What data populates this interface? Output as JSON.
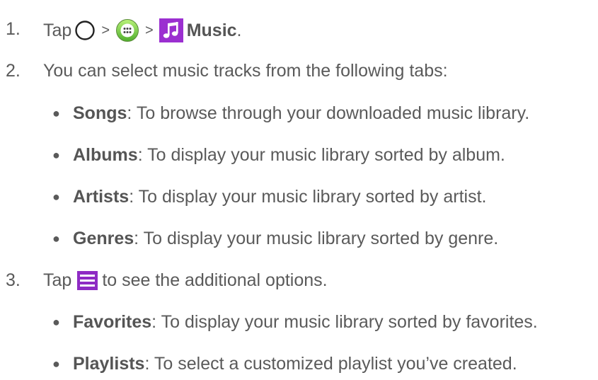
{
  "step1": {
    "number": "1.",
    "tap": "Tap",
    "sep1": ">",
    "sep2": ">",
    "music": "Music",
    "period": ".",
    "icons": [
      "home-icon",
      "apps-icon",
      "music-app-icon"
    ],
    "music_icon_color": "#9b2fd0"
  },
  "step2": {
    "number": "2.",
    "text": "You can select music tracks from the following tabs:",
    "bullets": [
      {
        "term": "Songs",
        "desc": ": To browse through your downloaded music library."
      },
      {
        "term": "Albums",
        "desc": ": To display your music library sorted by album."
      },
      {
        "term": "Artists",
        "desc": ": To display your music library sorted by artist."
      },
      {
        "term": "Genres",
        "desc": ": To display your music library sorted by genre."
      }
    ]
  },
  "step3": {
    "number": "3.",
    "tap": "Tap",
    "rest": "to see the additional options.",
    "icon": "menu-icon",
    "menu_icon_color": "#8e2bc4",
    "bullets": [
      {
        "term": "Favorites",
        "desc": ": To display your music library sorted by favorites."
      },
      {
        "term": "Playlists",
        "desc": ": To select a customized playlist you’ve created."
      }
    ]
  }
}
